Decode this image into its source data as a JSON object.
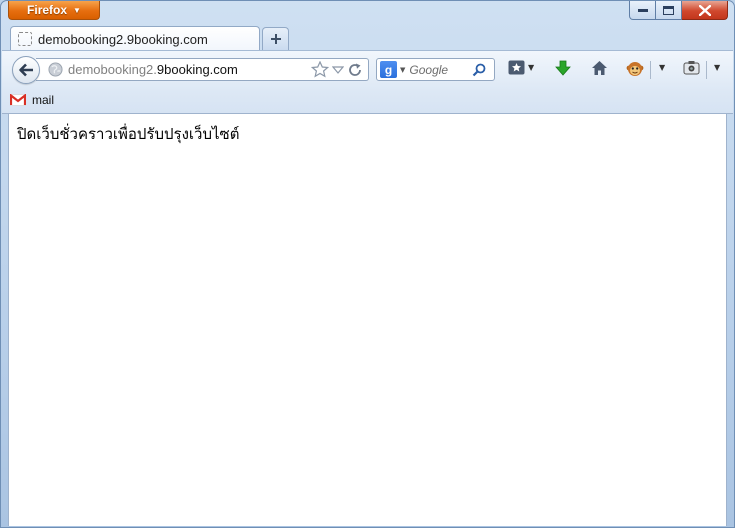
{
  "app": {
    "menu_button_label": "Firefox"
  },
  "tabs": [
    {
      "title": "demobooking2.9booking.com",
      "active": true
    }
  ],
  "navbar": {
    "url_prefix": "demobooking2.",
    "url_host": "9booking.com",
    "search_engine_letter": "g",
    "search_placeholder": "Google"
  },
  "bookmarks": [
    {
      "label": "mail",
      "icon": "gmail-icon"
    }
  ],
  "page": {
    "body_text": "ปิดเว็บชั่วคราวเพื่อปรับปรุงเว็บไซต์"
  },
  "colors": {
    "firefox_orange": "#e66e0f",
    "close_red": "#c3361c",
    "download_green": "#2aa52a",
    "chrome_blue": "#cfe0f2"
  }
}
